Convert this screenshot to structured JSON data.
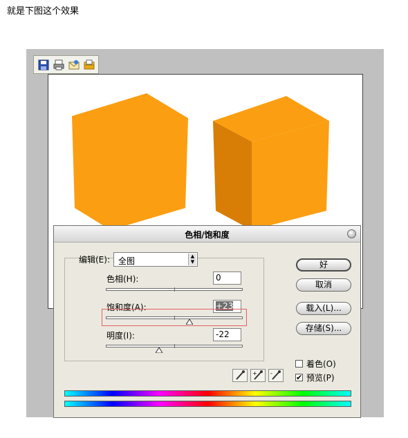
{
  "caption": "就是下图这个效果",
  "toolbar": {
    "icons": [
      "save-icon",
      "print-icon",
      "email-icon",
      "open-folder-icon"
    ]
  },
  "canvas": {
    "colors": {
      "cube_front": "#fb9e11",
      "cube_side": "#d87d06"
    }
  },
  "dialog": {
    "title": "色相/饱和度",
    "edit_label": "编辑(E):",
    "edit_value": "全图",
    "hue_label": "色相(H):",
    "hue_value": "0",
    "saturation_label": "饱和度(A):",
    "saturation_value": "+23",
    "lightness_label": "明度(I):",
    "lightness_value": "-22",
    "buttons": {
      "ok": "好",
      "cancel": "取消",
      "load": "载入(L)...",
      "save": "存储(S)..."
    },
    "colorize_label": "着色(O)",
    "colorize_checked": false,
    "preview_label": "预览(P)",
    "preview_checked": true,
    "check_glyph": "✔",
    "eyedroppers": [
      "eyedropper-icon",
      "eyedropper-plus-icon",
      "eyedropper-minus-icon"
    ]
  }
}
